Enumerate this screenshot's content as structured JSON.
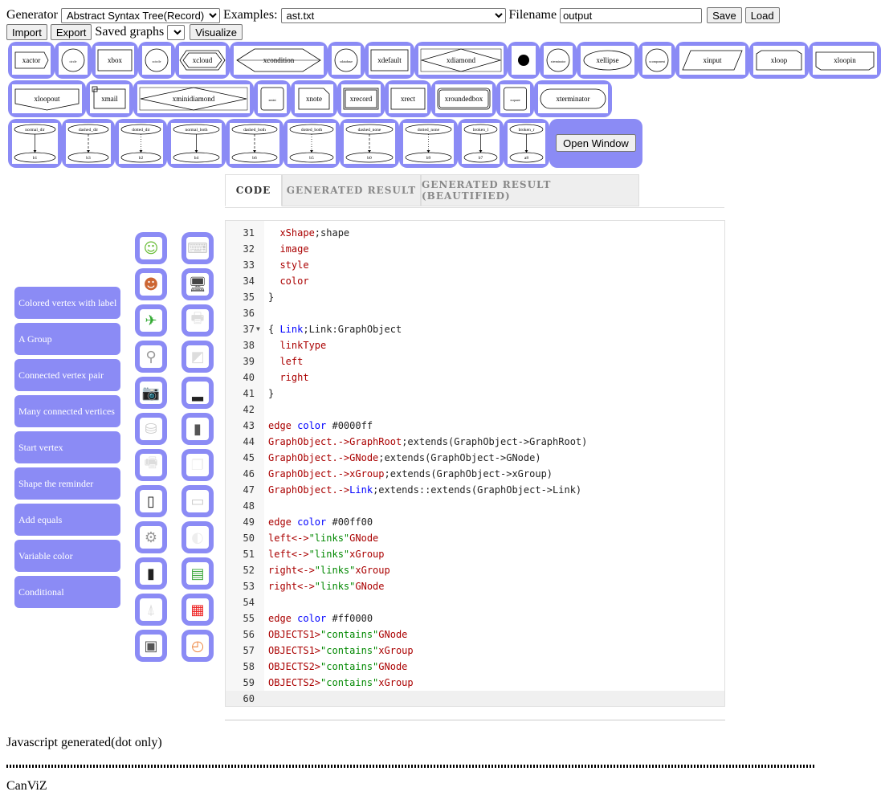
{
  "toolbar": {
    "generator_label": "Generator",
    "generator_value": "Abstract Syntax Tree(Record)",
    "examples_label": "Examples:",
    "examples_value": "ast.txt",
    "filename_label": "Filename",
    "filename_value": "output",
    "save_label": "Save",
    "load_label": "Load",
    "import_label": "Import",
    "export_label": "Export",
    "saved_graphs_label": "Saved graphs",
    "visualize_label": "Visualize"
  },
  "shapes": [
    {
      "label": "xactor"
    },
    {
      "label": "circle"
    },
    {
      "label": "xbox"
    },
    {
      "label": "xcircle"
    },
    {
      "label": "xcloud"
    },
    {
      "label": "xcondition"
    },
    {
      "label": "xdatabase"
    },
    {
      "label": "xdefault"
    },
    {
      "label": "xdiamond"
    },
    {
      "label": ""
    },
    {
      "label": "xterminator"
    },
    {
      "label": "xellipse"
    },
    {
      "label": "xcomponent"
    },
    {
      "label": "xinput"
    },
    {
      "label": "xloop"
    },
    {
      "label": "xloopin"
    },
    {
      "label": "xloopout"
    },
    {
      "label": "xmail"
    },
    {
      "label": "xminidiamond"
    },
    {
      "label": "xmini"
    },
    {
      "label": "xnote"
    },
    {
      "label": "xrecord"
    },
    {
      "label": "xrect"
    },
    {
      "label": "xroundedbox"
    },
    {
      "label": "xsquare"
    },
    {
      "label": "xterminator"
    }
  ],
  "edge_samples": [
    {
      "top": "normal_dir",
      "bottom": "b1"
    },
    {
      "top": "dashed_dir",
      "bottom": "b3"
    },
    {
      "top": "dotted_dir",
      "bottom": "b2"
    },
    {
      "top": "normal_both",
      "bottom": "b4"
    },
    {
      "top": "dashed_both",
      "bottom": "b6"
    },
    {
      "top": "dotted_both",
      "bottom": "b5"
    },
    {
      "top": "dashed_none",
      "bottom": "b0"
    },
    {
      "top": "dotted_none",
      "bottom": "b9"
    },
    {
      "top": "broken_l",
      "bottom": "b7"
    },
    {
      "top": "broken_r",
      "bottom": "a8"
    }
  ],
  "open_window_label": "Open Window",
  "tabs": [
    {
      "label": "CODE"
    },
    {
      "label": "GENERATED RESULT"
    },
    {
      "label": "GENERATED RESULT (BEAUTIFIED)"
    }
  ],
  "sidebar_buttons": [
    "Colored vertex with label",
    "A Group",
    "Connected vertex pair",
    "Many connected vertices",
    "Start vertex",
    "Shape the reminder",
    "Add equals",
    "Variable color",
    "Conditional"
  ],
  "icons": [
    {
      "name": "character-boy-icon"
    },
    {
      "name": "keyboard-icon"
    },
    {
      "name": "character-girl-icon"
    },
    {
      "name": "monitor-icon"
    },
    {
      "name": "satellite-icon"
    },
    {
      "name": "printer-icon"
    },
    {
      "name": "barcode-scanner-icon"
    },
    {
      "name": "scanner-icon"
    },
    {
      "name": "camera-icon"
    },
    {
      "name": "router-icon"
    },
    {
      "name": "hard-disk-icon"
    },
    {
      "name": "usb-drive-icon"
    },
    {
      "name": "fax-icon"
    },
    {
      "name": "documents-icon"
    },
    {
      "name": "mobile-phone-icon"
    },
    {
      "name": "laptop-icon"
    },
    {
      "name": "satellite-dish-icon"
    },
    {
      "name": "mouse-icon"
    },
    {
      "name": "flash-drive-icon"
    },
    {
      "name": "memory-module-icon"
    },
    {
      "name": "antenna-tower-icon"
    },
    {
      "name": "sim-card-icon"
    },
    {
      "name": "cpu-chip-icon"
    },
    {
      "name": "clock-icon"
    }
  ],
  "code_lines": [
    {
      "n": "31",
      "t": [
        [
          "k",
          "  xShape"
        ],
        [
          "d",
          ";shape"
        ]
      ]
    },
    {
      "n": "32",
      "t": [
        [
          "k",
          "  image"
        ]
      ]
    },
    {
      "n": "33",
      "t": [
        [
          "k",
          "  style"
        ]
      ]
    },
    {
      "n": "34",
      "t": [
        [
          "k",
          "  color"
        ]
      ]
    },
    {
      "n": "35",
      "t": [
        [
          "d",
          "}"
        ]
      ]
    },
    {
      "n": "36",
      "t": []
    },
    {
      "n": "37",
      "fold": true,
      "t": [
        [
          "d",
          "{ "
        ],
        [
          "b",
          "Link"
        ],
        [
          "d",
          ";Link:GraphObject"
        ]
      ]
    },
    {
      "n": "38",
      "t": [
        [
          "k",
          "  linkType"
        ]
      ]
    },
    {
      "n": "39",
      "t": [
        [
          "k",
          "  left"
        ]
      ]
    },
    {
      "n": "40",
      "t": [
        [
          "k",
          "  right"
        ]
      ]
    },
    {
      "n": "41",
      "t": [
        [
          "d",
          "}"
        ]
      ]
    },
    {
      "n": "42",
      "t": []
    },
    {
      "n": "43",
      "t": [
        [
          "k",
          "edge "
        ],
        [
          "b",
          "color"
        ],
        [
          "d",
          " #0000ff"
        ]
      ]
    },
    {
      "n": "44",
      "t": [
        [
          "k",
          "GraphObject.->"
        ],
        [
          "k",
          "GraphRoot"
        ],
        [
          "d",
          ";extends(GraphObject->GraphRoot)"
        ]
      ]
    },
    {
      "n": "45",
      "t": [
        [
          "k",
          "GraphObject.->"
        ],
        [
          "k",
          "GNode"
        ],
        [
          "d",
          ";extends(GraphObject->GNode)"
        ]
      ]
    },
    {
      "n": "46",
      "t": [
        [
          "k",
          "GraphObject.->"
        ],
        [
          "k",
          "xGroup"
        ],
        [
          "d",
          ";extends(GraphObject->xGroup)"
        ]
      ]
    },
    {
      "n": "47",
      "t": [
        [
          "k",
          "GraphObject.->"
        ],
        [
          "b",
          "Link"
        ],
        [
          "d",
          ";extends::extends(GraphObject->Link)"
        ]
      ]
    },
    {
      "n": "48",
      "t": []
    },
    {
      "n": "49",
      "t": [
        [
          "k",
          "edge "
        ],
        [
          "b",
          "color"
        ],
        [
          "d",
          " #00ff00"
        ]
      ]
    },
    {
      "n": "50",
      "t": [
        [
          "k",
          "left<->"
        ],
        [
          "g",
          "\"links\""
        ],
        [
          "k",
          "GNode"
        ]
      ]
    },
    {
      "n": "51",
      "t": [
        [
          "k",
          "left<->"
        ],
        [
          "g",
          "\"links\""
        ],
        [
          "k",
          "xGroup"
        ]
      ]
    },
    {
      "n": "52",
      "t": [
        [
          "k",
          "right<->"
        ],
        [
          "g",
          "\"links\""
        ],
        [
          "k",
          "xGroup"
        ]
      ]
    },
    {
      "n": "53",
      "t": [
        [
          "k",
          "right<->"
        ],
        [
          "g",
          "\"links\""
        ],
        [
          "k",
          "GNode"
        ]
      ]
    },
    {
      "n": "54",
      "t": []
    },
    {
      "n": "55",
      "t": [
        [
          "k",
          "edge "
        ],
        [
          "b",
          "color"
        ],
        [
          "d",
          " #ff0000"
        ]
      ]
    },
    {
      "n": "56",
      "t": [
        [
          "k",
          "OBJECTS1>"
        ],
        [
          "g",
          "\"contains\""
        ],
        [
          "k",
          "GNode"
        ]
      ]
    },
    {
      "n": "57",
      "t": [
        [
          "k",
          "OBJECTS1>"
        ],
        [
          "g",
          "\"contains\""
        ],
        [
          "k",
          "xGroup"
        ]
      ]
    },
    {
      "n": "58",
      "t": [
        [
          "k",
          "OBJECTS2>"
        ],
        [
          "g",
          "\"contains\""
        ],
        [
          "k",
          "GNode"
        ]
      ]
    },
    {
      "n": "59",
      "t": [
        [
          "k",
          "OBJECTS2>"
        ],
        [
          "g",
          "\"contains\""
        ],
        [
          "k",
          "xGroup"
        ]
      ]
    },
    {
      "n": "60",
      "cur": true,
      "t": []
    }
  ],
  "js_generated_label": "Javascript generated(dot only)",
  "canviz_label": "CanViZ",
  "colors": {
    "accent": "#8b8bf5",
    "keyword": "#aa0000",
    "type": "#0000ff",
    "string": "#008800"
  }
}
